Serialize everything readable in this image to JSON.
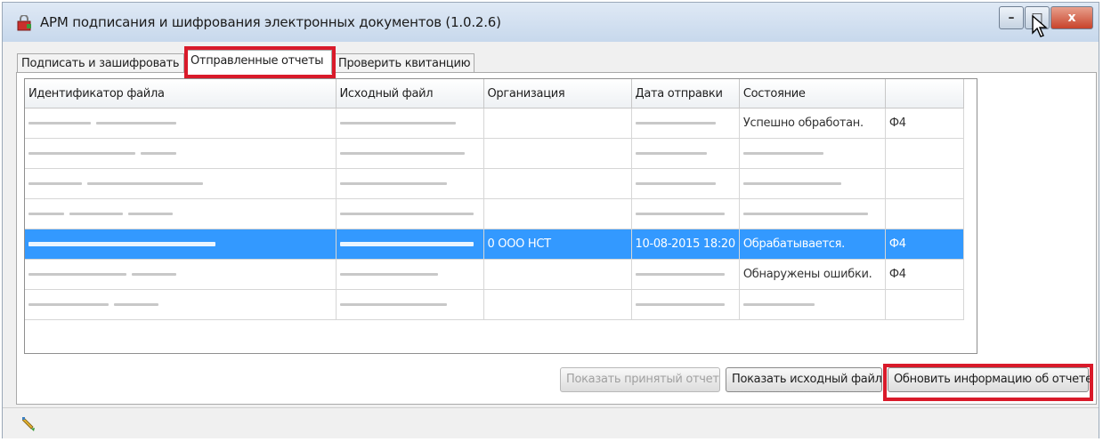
{
  "window": {
    "title": "АРМ подписания и шифрования электронных документов (1.0.2.6)"
  },
  "tabs": [
    {
      "label": "Подписать и зашифровать"
    },
    {
      "label": "Отправленные отчеты"
    },
    {
      "label": "Проверить квитанцию"
    }
  ],
  "grid": {
    "columns": [
      "Идентификатор файла",
      "Исходный файл",
      "Организация",
      "Дата отправки",
      "Состояние",
      ""
    ],
    "rows": [
      {
        "org": "",
        "date": "",
        "status": "Успешно обработан.",
        "form": "Ф4"
      },
      {
        "org": "",
        "date": "",
        "status": "",
        "form": ""
      },
      {
        "org": "",
        "date": "",
        "status": "",
        "form": ""
      },
      {
        "org": "",
        "date": "",
        "status": "",
        "form": ""
      },
      {
        "org": "0 ООО НСТ",
        "date": "10-08-2015 18:20",
        "status": "Обрабатывается.",
        "form": "Ф4"
      },
      {
        "org": "",
        "date": "",
        "status": "Обнаружены ошибки.",
        "form": "Ф4"
      },
      {
        "org": "",
        "date": "",
        "status": "",
        "form": ""
      }
    ]
  },
  "buttons": {
    "show_accepted": "Показать принятый отчет",
    "show_source": "Показать исходный файл",
    "refresh_info": "Обновить информацию об отчете"
  },
  "colors": {
    "highlight": "#d91a2a",
    "selection": "#3399ff"
  }
}
